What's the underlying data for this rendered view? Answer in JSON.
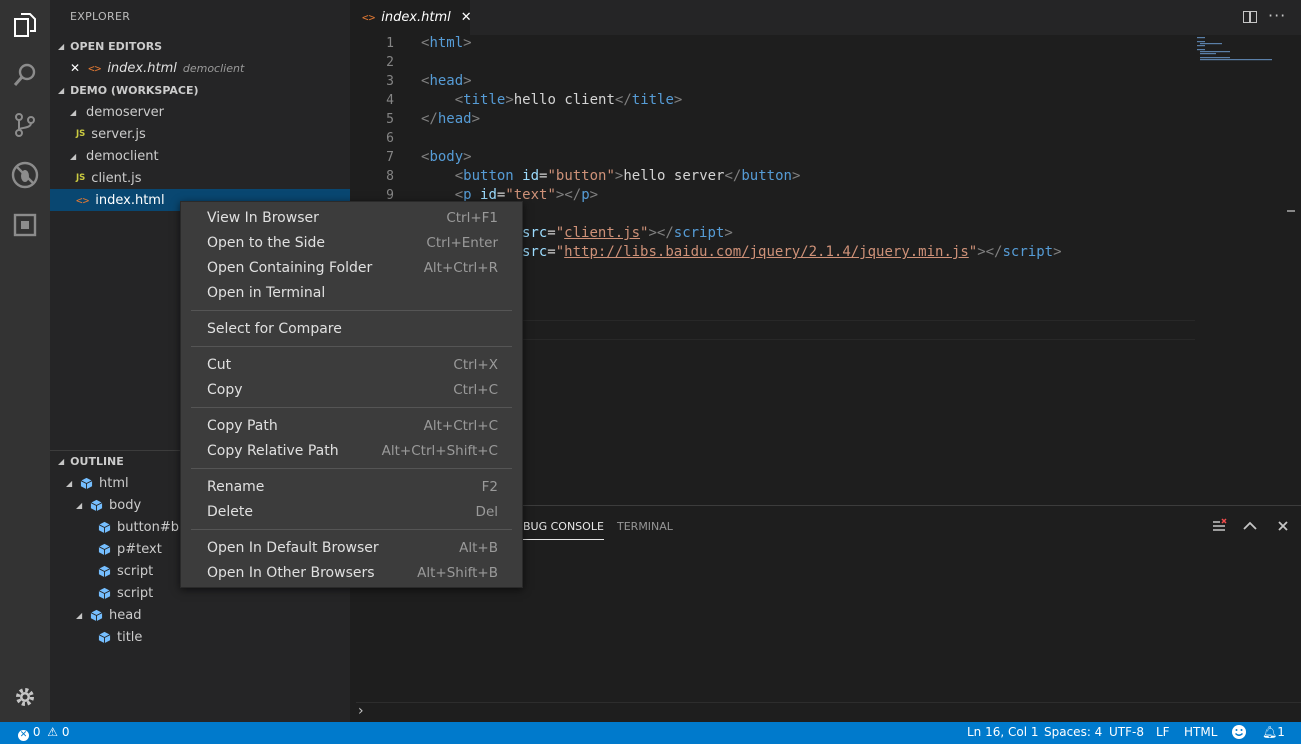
{
  "activity_bar": {
    "items": [
      {
        "name": "explorer-icon"
      },
      {
        "name": "search-icon"
      },
      {
        "name": "source-control-icon"
      },
      {
        "name": "debug-icon"
      },
      {
        "name": "extensions-icon"
      }
    ],
    "settings": "gear-icon"
  },
  "sidebar": {
    "title": "EXPLORER",
    "open_editors": {
      "header": "OPEN EDITORS",
      "item": {
        "close": "✕",
        "file": "index.html",
        "folder": "democlient"
      }
    },
    "workspace": {
      "header": "DEMO (WORKSPACE)",
      "items": [
        {
          "label": "demoserver",
          "type": "folder"
        },
        {
          "label": "server.js",
          "type": "js"
        },
        {
          "label": "democlient",
          "type": "folder"
        },
        {
          "label": "client.js",
          "type": "js"
        },
        {
          "label": "index.html",
          "type": "html",
          "selected": true
        }
      ]
    },
    "outline": {
      "header": "OUTLINE",
      "items": [
        {
          "label": "html",
          "depth": 0,
          "expanded": true
        },
        {
          "label": "body",
          "depth": 1,
          "expanded": true
        },
        {
          "label": "button#bu",
          "depth": 2
        },
        {
          "label": "p#text",
          "depth": 2
        },
        {
          "label": "script",
          "depth": 2
        },
        {
          "label": "script",
          "depth": 2
        },
        {
          "label": "head",
          "depth": 1,
          "expanded": true
        },
        {
          "label": "title",
          "depth": 2
        }
      ]
    }
  },
  "editor": {
    "tab": {
      "label": "index.html",
      "close": "✕"
    },
    "line_numbers": [
      "1",
      "2",
      "3",
      "4",
      "5",
      "6",
      "7",
      "8",
      "9"
    ],
    "code": {
      "l1": {
        "o": "<",
        "t": "html",
        "c": ">"
      },
      "l3": {
        "o": "<",
        "t": "head",
        "c": ">"
      },
      "l4": {
        "o": "<",
        "t": "title",
        "c": ">",
        "text": "hello client",
        "o2": "</",
        "t2": "title",
        "c2": ">"
      },
      "l5": {
        "o": "</",
        "t": "head",
        "c": ">"
      },
      "l7": {
        "o": "<",
        "t": "body",
        "c": ">"
      },
      "l8": {
        "o": "<",
        "t": "button",
        "a": "id",
        "eq": "=",
        "v": "\"button\"",
        "c": ">",
        "text": "hello server",
        "o2": "</",
        "t2": "button",
        "c2": ">"
      },
      "l9": {
        "o": "<",
        "t": "p",
        "a": "id",
        "eq": "=",
        "v": "\"text\"",
        "c": "></",
        "t2": "p",
        "c2": ">"
      },
      "l10": {
        "a": "src",
        "eq": "=",
        "q1": "\"",
        "url": "client.js",
        "q2": "\"",
        "c": "></",
        "t2": "script",
        "c2": ">"
      },
      "l11": {
        "a": "src",
        "eq": "=",
        "q1": "\"",
        "url": "http://libs.baidu.com/jquery/2.1.4/jquery.min.js",
        "q2": "\"",
        "c": "></",
        "t2": "script",
        "c2": ">"
      }
    }
  },
  "panel": {
    "tabs": [
      "BUG CONSOLE",
      "TERMINAL"
    ],
    "prompt": "›"
  },
  "context_menu": {
    "groups": [
      [
        {
          "label": "View In Browser",
          "key": "Ctrl+F1"
        },
        {
          "label": "Open to the Side",
          "key": "Ctrl+Enter"
        },
        {
          "label": "Open Containing Folder",
          "key": "Alt+Ctrl+R"
        },
        {
          "label": "Open in Terminal",
          "key": ""
        }
      ],
      [
        {
          "label": "Select for Compare",
          "key": ""
        }
      ],
      [
        {
          "label": "Cut",
          "key": "Ctrl+X"
        },
        {
          "label": "Copy",
          "key": "Ctrl+C"
        }
      ],
      [
        {
          "label": "Copy Path",
          "key": "Alt+Ctrl+C"
        },
        {
          "label": "Copy Relative Path",
          "key": "Alt+Ctrl+Shift+C"
        }
      ],
      [
        {
          "label": "Rename",
          "key": "F2"
        },
        {
          "label": "Delete",
          "key": "Del"
        }
      ],
      [
        {
          "label": "Open In Default Browser",
          "key": "Alt+B"
        },
        {
          "label": "Open In Other Browsers",
          "key": "Alt+Shift+B"
        }
      ]
    ]
  },
  "status_bar": {
    "errors": "0",
    "warnings": "0",
    "position": "Ln 16, Col 1",
    "spaces": "Spaces: 4",
    "encoding": "UTF-8",
    "eol": "LF",
    "language": "HTML",
    "notifications": "1"
  },
  "colors": {
    "status_bar": "#007acc",
    "activity_bar": "#333333",
    "sidebar": "#252526",
    "editor": "#1e1e1e",
    "selection": "#094771",
    "menu": "#3c3c3c"
  }
}
